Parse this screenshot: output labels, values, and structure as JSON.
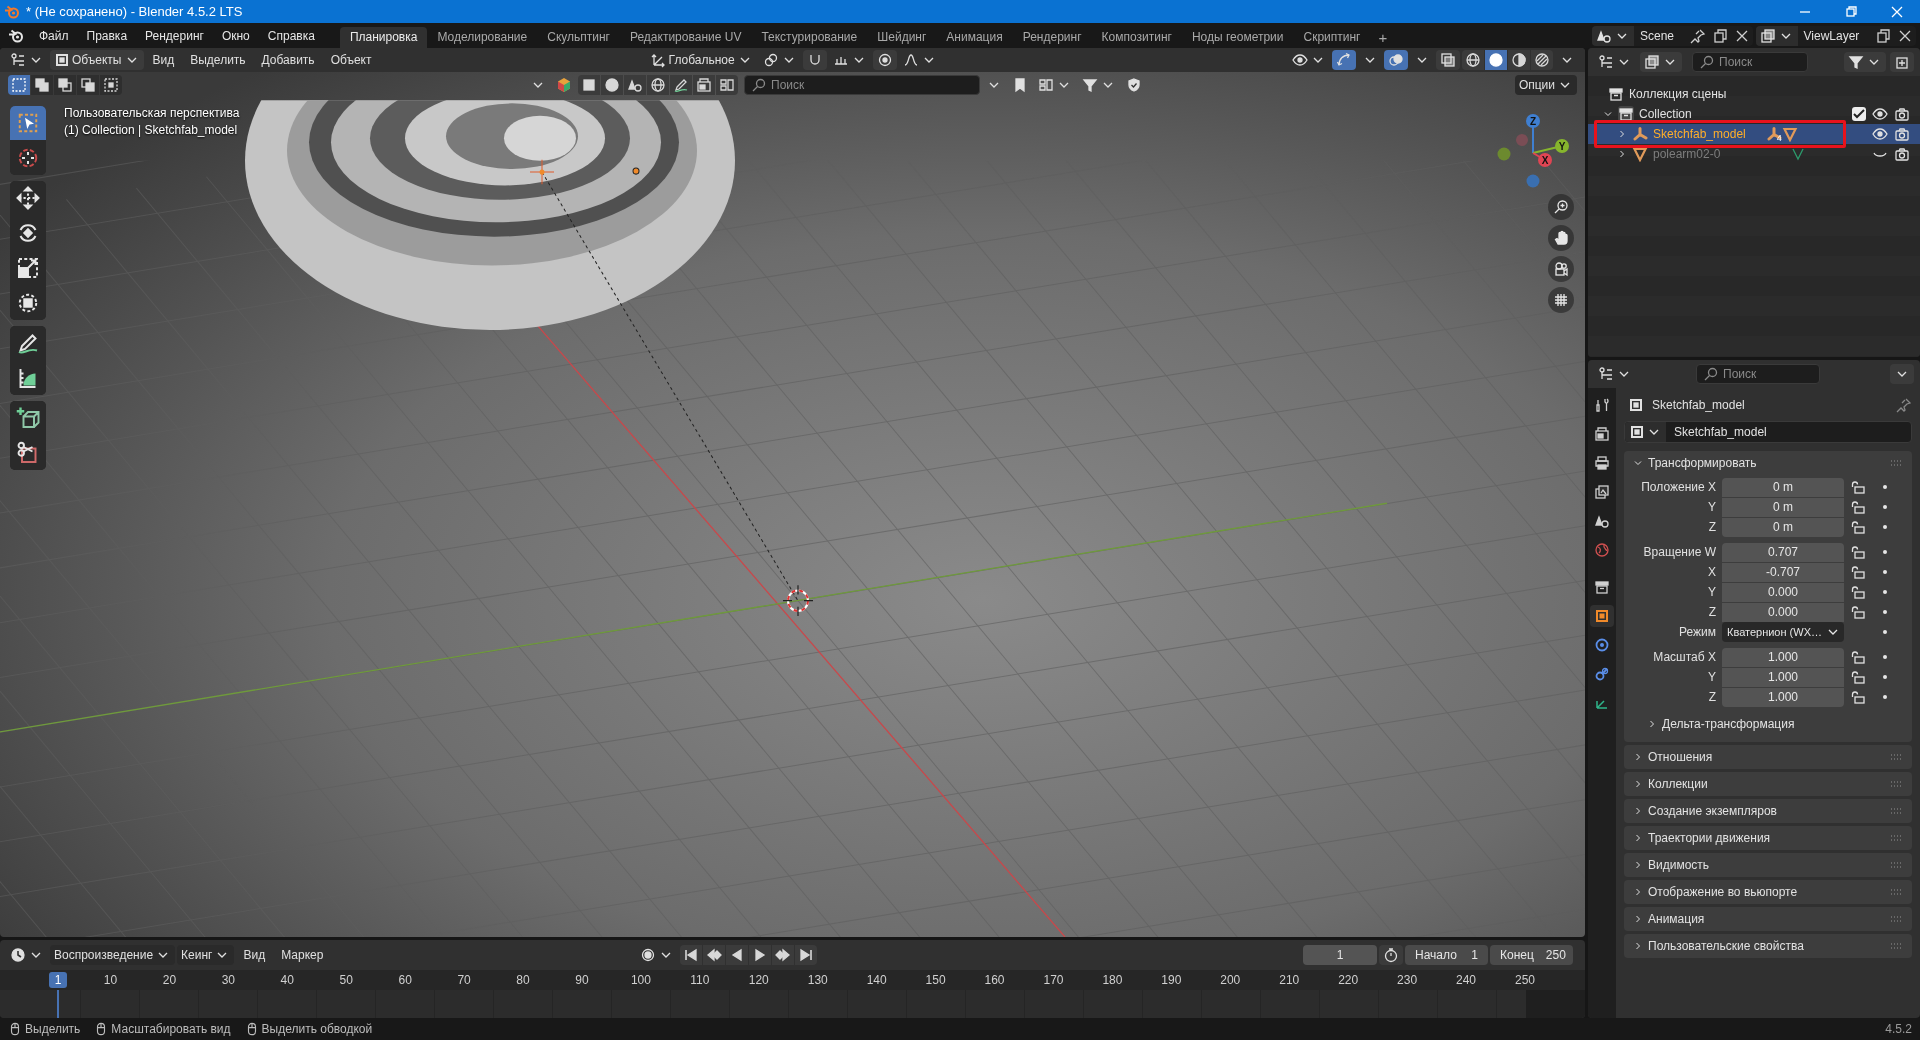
{
  "window": {
    "title": "* (Не сохранено) - Blender 4.5.2 LTS"
  },
  "menu": [
    "Файл",
    "Правка",
    "Рендеринг",
    "Окно",
    "Справка"
  ],
  "workspaces": [
    {
      "label": "Планировка",
      "selected": true
    },
    {
      "label": "Моделирование",
      "selected": false
    },
    {
      "label": "Скульптинг",
      "selected": false
    },
    {
      "label": "Редактирование UV",
      "selected": false
    },
    {
      "label": "Текстурирование",
      "selected": false
    },
    {
      "label": "Шейдинг",
      "selected": false
    },
    {
      "label": "Анимация",
      "selected": false
    },
    {
      "label": "Рендеринг",
      "selected": false
    },
    {
      "label": "Композитинг",
      "selected": false
    },
    {
      "label": "Ноды геометрии",
      "selected": false
    },
    {
      "label": "Скриптинг",
      "selected": false
    }
  ],
  "add_workspace": "+",
  "scene": "Scene",
  "view_layer": "ViewLayer",
  "viewport": {
    "mode": "Объекты",
    "menus": [
      "Вид",
      "Выделить",
      "Добавить",
      "Объект"
    ],
    "orientation": "Глобальное",
    "search": {
      "placeholder": "Поиск"
    },
    "options": "Опции",
    "shading": [
      {
        "kind": "wireframe",
        "selected": false
      },
      {
        "kind": "solid",
        "selected": true
      },
      {
        "kind": "material",
        "selected": false
      },
      {
        "kind": "rendered",
        "selected": false
      }
    ],
    "select_modes": [
      {
        "kind": "set",
        "selected": true
      },
      {
        "kind": "extend",
        "selected": false
      },
      {
        "kind": "subtract",
        "selected": false
      },
      {
        "kind": "invert",
        "selected": false
      },
      {
        "kind": "intersect",
        "selected": false
      }
    ],
    "view_name": "Пользовательская перспектива",
    "context": "(1) Collection | Sketchfab_model",
    "tool_groups": [
      [
        {
          "kind": "select",
          "selected": true
        },
        {
          "kind": "cursor",
          "selected": false
        }
      ],
      [
        {
          "kind": "move",
          "selected": false
        },
        {
          "kind": "rotate",
          "selected": false
        },
        {
          "kind": "scale",
          "selected": false
        },
        {
          "kind": "transform",
          "selected": false
        }
      ],
      [
        {
          "kind": "annotate",
          "selected": false
        },
        {
          "kind": "measure",
          "selected": false
        }
      ],
      [
        {
          "kind": "add_cube",
          "selected": false
        },
        {
          "kind": "cut",
          "selected": false
        }
      ]
    ],
    "gizmo_axes": [
      "Z",
      "Y",
      "X"
    ]
  },
  "outliner": {
    "search": {
      "placeholder": "Поиск"
    },
    "tree": {
      "label": "Коллекция сцены",
      "children": [
        {
          "label": "Collection",
          "kind": "collection",
          "expanded": true,
          "checked": true,
          "visible": true,
          "selected": false,
          "annotated": false,
          "children": [
            {
              "label": "Sketchfab_model",
              "kind": "empty",
              "expanded": false,
              "visible": true,
              "selected": true,
              "annotated": true,
              "child_count": "4"
            },
            {
              "label": "polearm02-0",
              "kind": "mesh",
              "expanded": false,
              "visible": false,
              "selected": false,
              "annotated": false
            }
          ]
        }
      ]
    }
  },
  "properties": {
    "search": {
      "placeholder": "Поиск"
    },
    "tabs": [
      {
        "kind": "tool",
        "selected": false
      },
      {
        "kind": "render",
        "selected": false
      },
      {
        "kind": "output",
        "selected": false
      },
      {
        "kind": "view_layer",
        "selected": false
      },
      {
        "kind": "scene",
        "selected": false
      },
      {
        "kind": "world",
        "selected": false
      },
      {
        "kind": "collection",
        "selected": false
      },
      {
        "kind": "object",
        "selected": true
      },
      {
        "kind": "physics",
        "selected": false
      },
      {
        "kind": "constraints",
        "selected": false
      },
      {
        "kind": "data",
        "selected": false
      }
    ],
    "object_name": "Sketchfab_model",
    "datablock": "Sketchfab_model",
    "transform": {
      "label": "Трансформировать",
      "expanded": true,
      "groups": [
        [
          {
            "label": "Положение X",
            "value": "0 m",
            "kind": "number"
          },
          {
            "label": "Y",
            "value": "0 m",
            "kind": "number"
          },
          {
            "label": "Z",
            "value": "0 m",
            "kind": "number"
          }
        ],
        [
          {
            "label": "Вращение W",
            "value": "0.707",
            "kind": "number"
          },
          {
            "label": "X",
            "value": "-0.707",
            "kind": "number"
          },
          {
            "label": "Y",
            "value": "0.000",
            "kind": "number"
          },
          {
            "label": "Z",
            "value": "0.000",
            "kind": "number"
          },
          {
            "label": "Режим",
            "value": "Кватернион (WX…",
            "kind": "dropdown"
          }
        ],
        [
          {
            "label": "Масштаб X",
            "value": "1.000",
            "kind": "number"
          },
          {
            "label": "Y",
            "value": "1.000",
            "kind": "number"
          },
          {
            "label": "Z",
            "value": "1.000",
            "kind": "number"
          }
        ]
      ],
      "subpanel": {
        "label": "Дельта-трансформация",
        "expanded": false
      }
    },
    "panels": [
      {
        "label": "Отношения",
        "expanded": false
      },
      {
        "label": "Коллекции",
        "expanded": false
      },
      {
        "label": "Создание экземпляров",
        "expanded": false
      },
      {
        "label": "Траектории движения",
        "expanded": false
      },
      {
        "label": "Видимость",
        "expanded": false
      },
      {
        "label": "Отображение во вьюпорте",
        "expanded": false
      },
      {
        "label": "Анимация",
        "expanded": false
      },
      {
        "label": "Пользовательские свойства",
        "expanded": false
      }
    ]
  },
  "timeline": {
    "menus": [
      {
        "label": "Воспроизведение",
        "kind": "dropdown"
      },
      {
        "label": "Кеинг",
        "kind": "dropdown"
      },
      {
        "label": "Вид",
        "kind": "menu"
      },
      {
        "label": "Маркер",
        "kind": "menu"
      }
    ],
    "current_frame": "1",
    "start_label": "Начало",
    "start": "1",
    "end_label": "Конец",
    "end": "250",
    "playhead": "1",
    "ruler": [
      "10",
      "20",
      "30",
      "40",
      "50",
      "60",
      "70",
      "80",
      "90",
      "100",
      "110",
      "120",
      "130",
      "140",
      "150",
      "160",
      "170",
      "180",
      "190",
      "200",
      "210",
      "220",
      "230",
      "240",
      "250"
    ]
  },
  "status": {
    "hints": [
      "Выделить",
      "Масштабировать вид",
      "Выделить обводкой"
    ],
    "version": "4.5.2"
  }
}
